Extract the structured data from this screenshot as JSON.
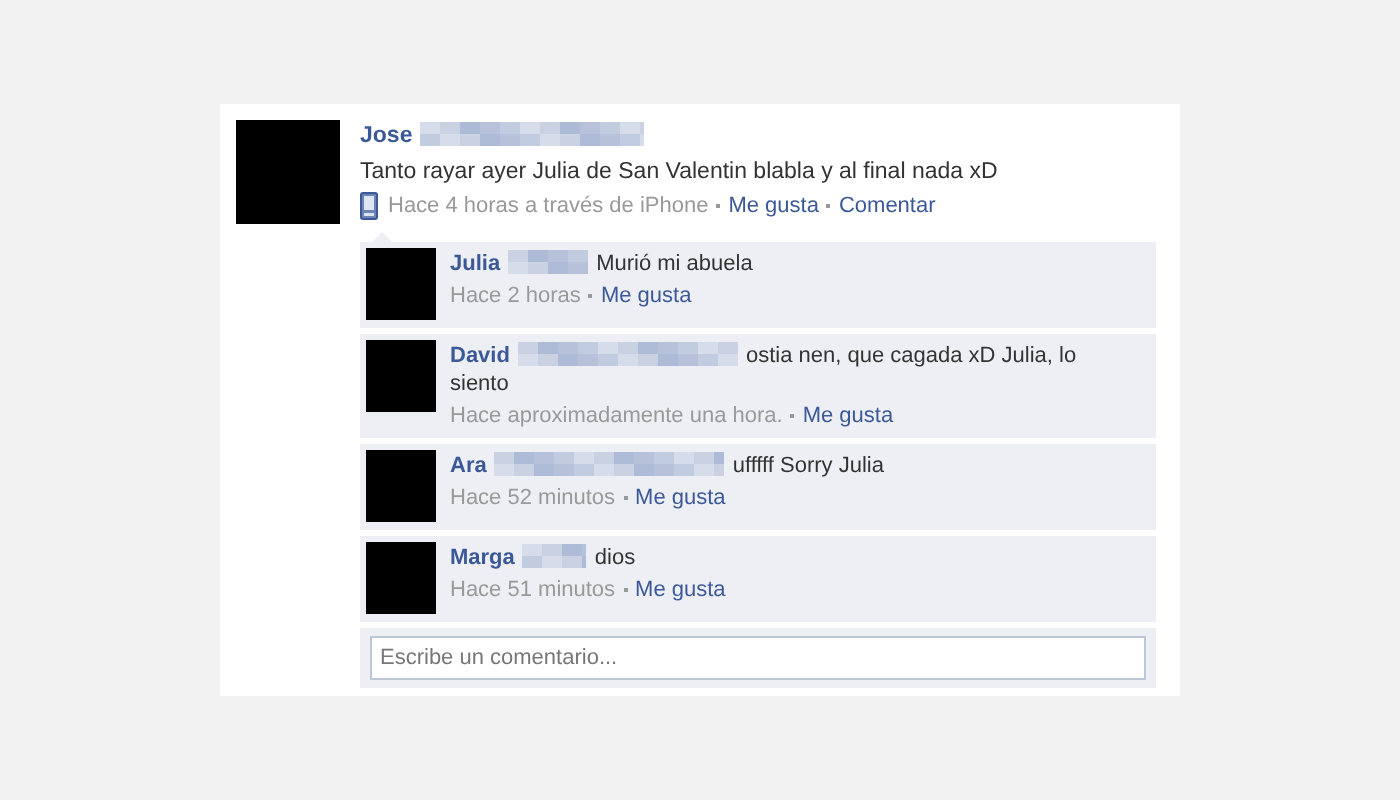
{
  "post": {
    "author": "Jose",
    "text": "Tanto rayar ayer Julia de San Valentin blabla y al final nada xD",
    "time": "Hace 4 horas a través de iPhone",
    "like_link": "Me gusta",
    "comment_link": "Comentar"
  },
  "comments": [
    {
      "author": "Julia",
      "text": "Murió mi abuela",
      "time": "Hace 2 horas",
      "like_link": "Me gusta"
    },
    {
      "author": "David",
      "text": "ostia nen, que cagada xD Julia, lo siento",
      "time": "Hace aproximadamente una hora.",
      "like_link": "Me gusta"
    },
    {
      "author": "Ara",
      "text": "ufffff Sorry Julia",
      "time": "Hace 52 minutos",
      "like_link": "Me gusta"
    },
    {
      "author": "Marga",
      "text": "dios",
      "time": "Hace 51 minutos",
      "like_link": "Me gusta"
    }
  ],
  "comment_field": {
    "placeholder": "Escribe un comentario..."
  }
}
